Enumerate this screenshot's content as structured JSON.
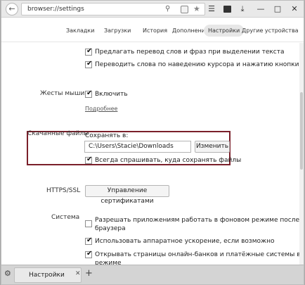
{
  "address_bar": {
    "url": "browser://settings"
  },
  "nav": {
    "tabs": [
      "Закладки",
      "Загрузки",
      "История",
      "Дополнения",
      "Настройки",
      "Другие устройства"
    ],
    "active": "Настройки"
  },
  "translation": {
    "options": [
      {
        "label": "Предлагать перевод слов и фраз при выделении текста",
        "checked": true
      },
      {
        "label": "Переводить слова по наведению курсора и нажатию кнопки Shift",
        "checked": true
      }
    ]
  },
  "mouse_gestures": {
    "label": "Жесты мыши",
    "enable_label": "Включить",
    "enable_checked": true,
    "more_link": "Подробнее"
  },
  "downloads": {
    "label": "Скачанные файлы",
    "save_to_label": "Сохранять в:",
    "path": "C:\\Users\\Stacie\\Downloads",
    "change_button": "Изменить",
    "always_ask_label": "Всегда спрашивать, куда сохранять файлы",
    "always_ask_checked": true
  },
  "https": {
    "label": "HTTPS/SSL",
    "cert_button": "Управление сертификатами"
  },
  "system": {
    "label": "Система",
    "options": [
      {
        "label_line1": "Разрешать приложениям работать в фоновом режиме после закрытия",
        "label_line2": "браузера",
        "checked": false
      },
      {
        "label_line1": "Использовать аппаратное ускорение, если возможно",
        "label_line2": "",
        "checked": true
      },
      {
        "label_line1": "Открывать страницы онлайн-банков и платёжные системы в защищенном",
        "label_line2": "режиме",
        "checked": true
      }
    ]
  },
  "bottom_tabs": {
    "active_tab_label": "Настройки"
  },
  "colors": {
    "highlight_border": "#7a1f2a",
    "nav_active_bg": "#e7e7e7"
  },
  "icons": [
    "back-arrow-icon",
    "search-icon",
    "extension-icon",
    "star-icon",
    "menu-icon",
    "window-icon",
    "download-icon",
    "minimize-icon",
    "maximize-icon",
    "close-icon",
    "gear-icon",
    "tab-close-icon",
    "plus-icon"
  ]
}
